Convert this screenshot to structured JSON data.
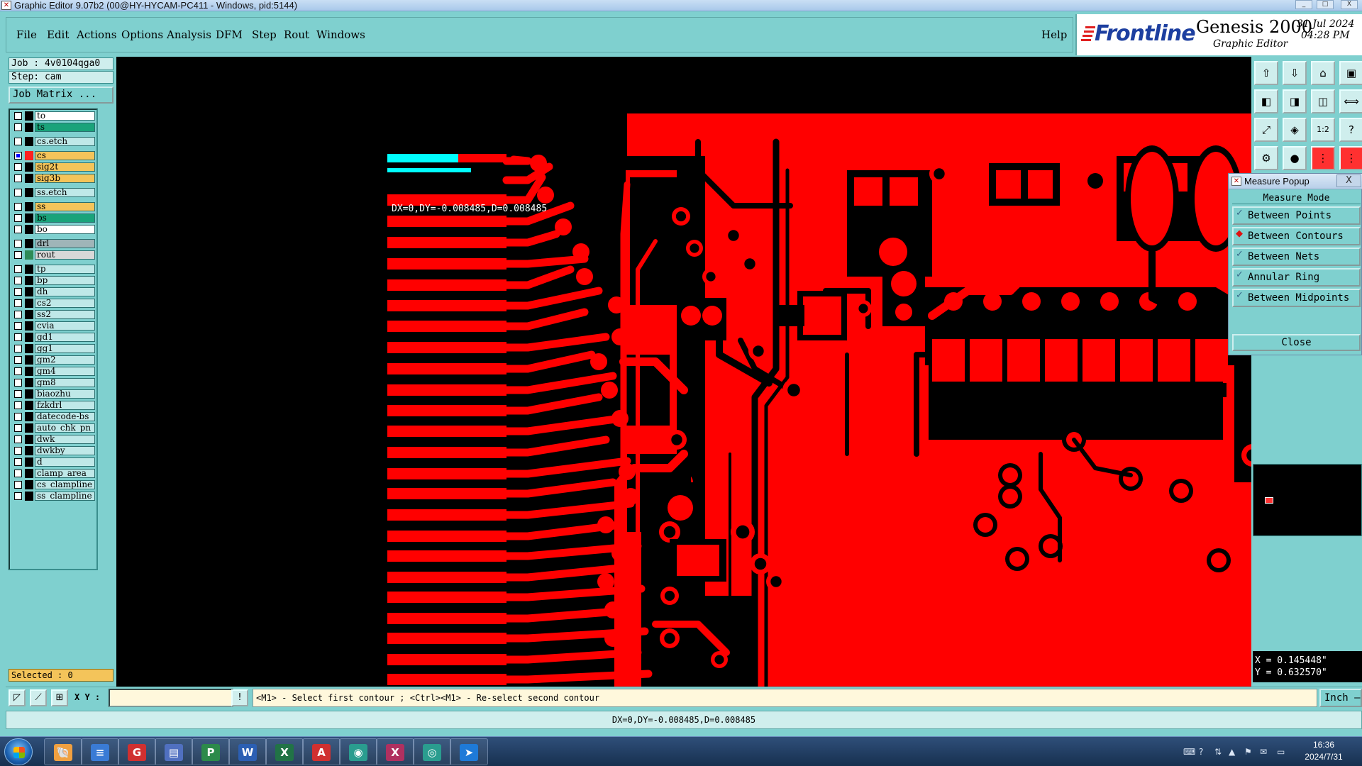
{
  "window": {
    "title": "Graphic Editor 9.07b2 (00@HY-HYCAM-PC411 - Windows, pid:5144)",
    "min": "_",
    "max": "□",
    "close": "X"
  },
  "menu": {
    "items": [
      "File",
      "Edit",
      "Actions",
      "Options",
      "Analysis",
      "DFM",
      "Step",
      "Rout",
      "Windows"
    ],
    "help": "Help"
  },
  "brand": {
    "logo": "Frontline",
    "product": "Genesis 2000",
    "subtitle": "Graphic Editor",
    "date": "31 Jul 2024",
    "time": "04:28 PM"
  },
  "left_panel": {
    "job": "Job : 4v0104qga0",
    "step": "Step: cam",
    "job_matrix": "Job Matrix ...",
    "selected": "Selected : 0",
    "layers": [
      {
        "name": "to",
        "color": "#ffffff",
        "swatch": "#000000",
        "checked": false
      },
      {
        "name": "ts",
        "color": "#1aa37a",
        "swatch": "#000000",
        "checked": false
      },
      {
        "name": "cs.etch",
        "color": "#bfe8e8",
        "swatch": "#000000",
        "checked": false
      },
      {
        "name": "cs",
        "color": "#f4c45a",
        "swatch": "#ff2020",
        "checked": true
      },
      {
        "name": "sig2t",
        "color": "#f4c45a",
        "swatch": "#000000",
        "checked": false
      },
      {
        "name": "sig3b",
        "color": "#f4c45a",
        "swatch": "#000000",
        "checked": false
      },
      {
        "name": "ss.etch",
        "color": "#bfe8e8",
        "swatch": "#000000",
        "checked": false
      },
      {
        "name": "ss",
        "color": "#f4c45a",
        "swatch": "#000000",
        "checked": false
      },
      {
        "name": "bs",
        "color": "#1aa37a",
        "swatch": "#000000",
        "checked": false
      },
      {
        "name": "bo",
        "color": "#ffffff",
        "swatch": "#000000",
        "checked": false
      },
      {
        "name": "drl",
        "color": "#9fb5b8",
        "swatch": "#000000",
        "checked": false
      },
      {
        "name": "rout",
        "color": "#d8d8d8",
        "swatch": "#2e8b57",
        "checked": false
      },
      {
        "name": "tp",
        "color": "#bfe8e8",
        "swatch": "#000000",
        "checked": false
      },
      {
        "name": "bp",
        "color": "#bfe8e8",
        "swatch": "#000000",
        "checked": false
      },
      {
        "name": "dh",
        "color": "#bfe8e8",
        "swatch": "#000000",
        "checked": false
      },
      {
        "name": "cs2",
        "color": "#bfe8e8",
        "swatch": "#000000",
        "checked": false
      },
      {
        "name": "ss2",
        "color": "#bfe8e8",
        "swatch": "#000000",
        "checked": false
      },
      {
        "name": "cvia",
        "color": "#bfe8e8",
        "swatch": "#000000",
        "checked": false
      },
      {
        "name": "gd1",
        "color": "#bfe8e8",
        "swatch": "#000000",
        "checked": false
      },
      {
        "name": "gg1",
        "color": "#bfe8e8",
        "swatch": "#000000",
        "checked": false
      },
      {
        "name": "gm2",
        "color": "#bfe8e8",
        "swatch": "#000000",
        "checked": false
      },
      {
        "name": "gm4",
        "color": "#bfe8e8",
        "swatch": "#000000",
        "checked": false
      },
      {
        "name": "gm8",
        "color": "#bfe8e8",
        "swatch": "#000000",
        "checked": false
      },
      {
        "name": "biaozhu",
        "color": "#bfe8e8",
        "swatch": "#000000",
        "checked": false
      },
      {
        "name": "fzkdrl",
        "color": "#bfe8e8",
        "swatch": "#000000",
        "checked": false
      },
      {
        "name": "datecode-bs",
        "color": "#bfe8e8",
        "swatch": "#000000",
        "checked": false
      },
      {
        "name": "auto_chk_pn",
        "color": "#bfe8e8",
        "swatch": "#000000",
        "checked": false
      },
      {
        "name": "dwk",
        "color": "#bfe8e8",
        "swatch": "#000000",
        "checked": false
      },
      {
        "name": "dwkby",
        "color": "#bfe8e8",
        "swatch": "#000000",
        "checked": false
      },
      {
        "name": "d",
        "color": "#bfe8e8",
        "swatch": "#000000",
        "checked": false
      },
      {
        "name": "clamp_area",
        "color": "#bfe8e8",
        "swatch": "#000000",
        "checked": false
      },
      {
        "name": "cs_clampline",
        "color": "#bfe8e8",
        "swatch": "#000000",
        "checked": false
      },
      {
        "name": "ss_clampline",
        "color": "#bfe8e8",
        "swatch": "#000000",
        "checked": false
      }
    ]
  },
  "canvas": {
    "measure_readout": "DX=0,DY=-0.008485,D=0.008485",
    "copper_color": "#ff0000",
    "highlight_color": "#00ffff"
  },
  "popup": {
    "title": "Measure Popup",
    "close_x": "X",
    "mode_label": "Measure Mode",
    "options": [
      {
        "label": "Between Points",
        "selected": false
      },
      {
        "label": "Between Contours",
        "selected": true
      },
      {
        "label": "Between Nets",
        "selected": false
      },
      {
        "label": "Annular Ring",
        "selected": false
      },
      {
        "label": "Between Midpoints",
        "selected": false
      }
    ],
    "close": "Close"
  },
  "right_panel": {
    "x": "X = 0.145448\"",
    "y": "Y = 0.632570\"",
    "tool_icons": [
      "zoom-in-icon",
      "zoom-out-icon",
      "home-icon",
      "window-icon",
      "pan-left-icon",
      "pan-right-icon",
      "zoom-area-icon",
      "measure-icon",
      "fit-icon",
      "zoom-center-icon",
      "scale-icon",
      "help-icon",
      "snap-icon",
      "net-icon",
      "layer-icon",
      "layer-active-icon"
    ]
  },
  "command_bar": {
    "xy_label": "X Y :",
    "xy_value": "",
    "info_button": "!",
    "message": "<M1> - Select first contour ; <Ctrl><M1> - Re-select second contour",
    "unit": "Inch"
  },
  "status": "DX=0,DY=-0.008485,D=0.008485",
  "taskbar": {
    "apps": [
      "shell-app",
      "notepad-app",
      "browser-app",
      "save-app",
      "publisher-app",
      "word-app",
      "excel-app",
      "pdf-app",
      "genesis-app",
      "exceed-app",
      "cam-app",
      "arrow-app"
    ],
    "time": "16:36",
    "date": "2024/7/31"
  }
}
